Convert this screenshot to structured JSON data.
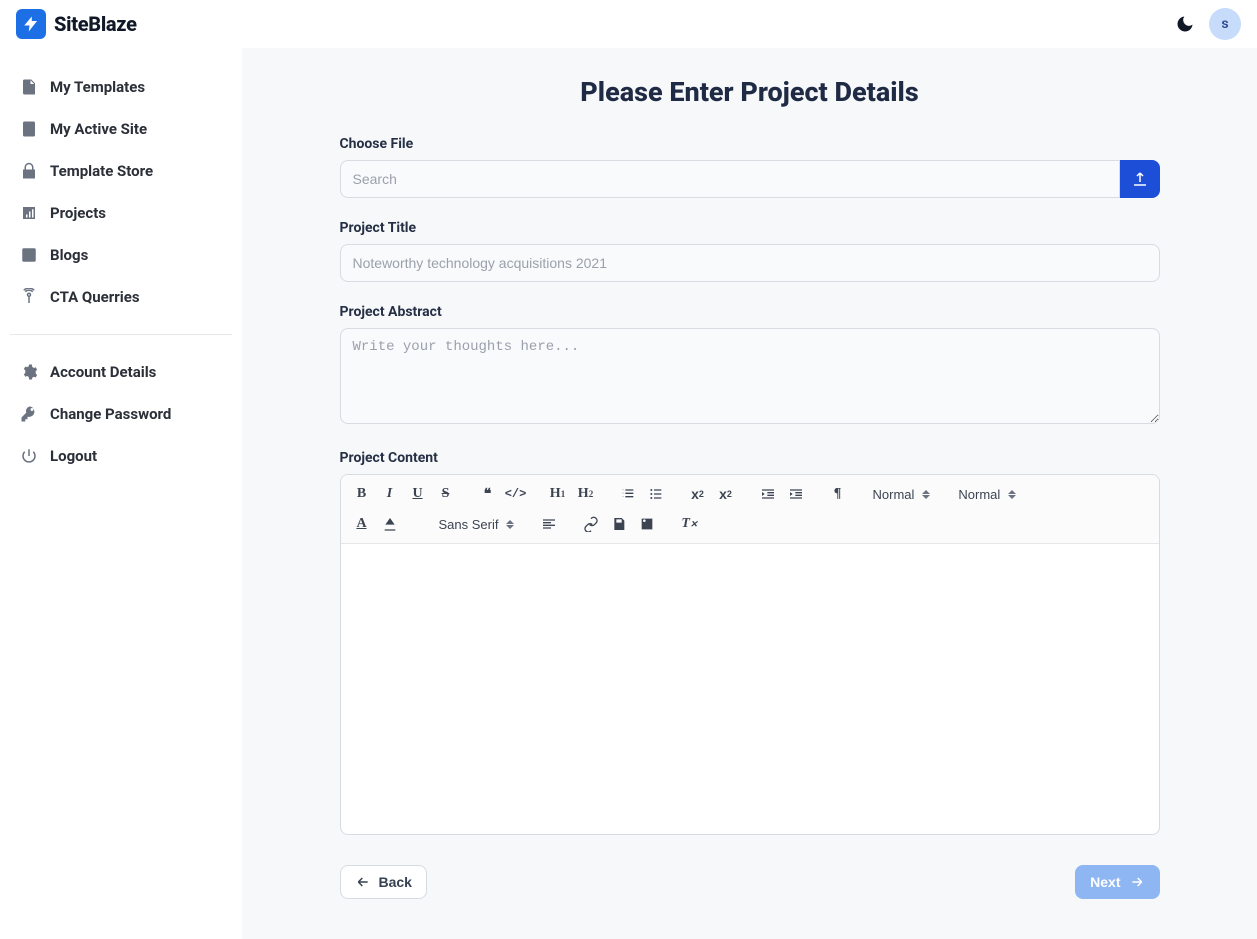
{
  "app": {
    "name": "SiteBlaze",
    "avatar_initial": "s"
  },
  "sidebar": {
    "primary": [
      {
        "label": "My Templates"
      },
      {
        "label": "My Active Site"
      },
      {
        "label": "Template Store"
      },
      {
        "label": "Projects"
      },
      {
        "label": "Blogs"
      },
      {
        "label": "CTA Querries"
      }
    ],
    "secondary": [
      {
        "label": "Account Details"
      },
      {
        "label": "Change Password"
      },
      {
        "label": "Logout"
      }
    ]
  },
  "page": {
    "title": "Please Enter Project Details"
  },
  "form": {
    "file_label": "Choose File",
    "file_placeholder": "Search",
    "title_label": "Project Title",
    "title_placeholder": "Noteworthy technology acquisitions 2021",
    "abstract_label": "Project Abstract",
    "abstract_placeholder": "Write your thoughts here...",
    "content_label": "Project Content"
  },
  "editor": {
    "font_family_label": "Sans Serif",
    "heading_label": "Normal",
    "size_label": "Normal"
  },
  "actions": {
    "back": "Back",
    "next": "Next"
  }
}
